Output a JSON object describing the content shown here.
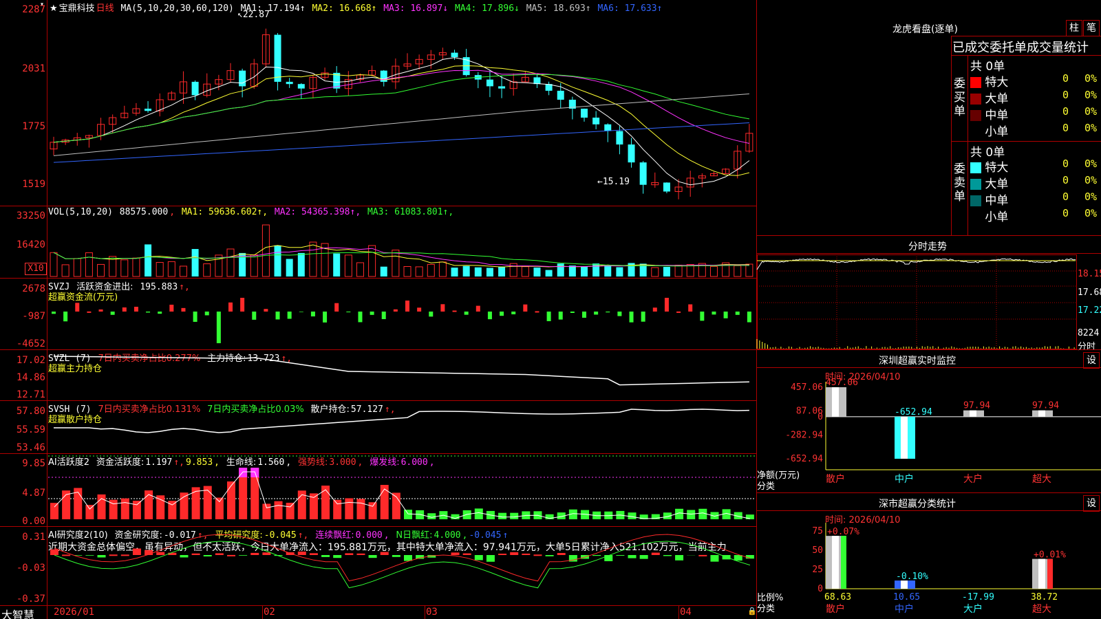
{
  "stock": {
    "name_prefix": "★",
    "name": "宝鼎科技",
    "period": "日线"
  },
  "kline": {
    "ma_header": "MA(5,10,20,30,60,120)",
    "ma": [
      {
        "label": "MA1:",
        "value": "17.194",
        "arrow": "↑",
        "color": "#ffffff"
      },
      {
        "label": "MA2:",
        "value": "16.668",
        "arrow": "↑",
        "color": "#ffff33"
      },
      {
        "label": "MA3:",
        "value": "16.897",
        "arrow": "↓",
        "color": "#ff33ff"
      },
      {
        "label": "MA4:",
        "value": "17.896",
        "arrow": "↓",
        "color": "#33ff33"
      },
      {
        "label": "MA5:",
        "value": "18.693",
        "arrow": "↑",
        "color": "#c0c0c0"
      },
      {
        "label": "MA6:",
        "value": "17.633",
        "arrow": "↑",
        "color": "#3366ff"
      }
    ],
    "y_ticks": [
      "2287",
      "2031",
      "1775",
      "1519"
    ],
    "high_label": "22.87",
    "low_label": "15.19"
  },
  "vol": {
    "header": "VOL(5,10,20)",
    "value": "88575.000",
    "ma": [
      {
        "label": "MA1:",
        "value": "59636.602",
        "color": "#ffff33"
      },
      {
        "label": "MA2:",
        "value": "54365.398",
        "color": "#ff33ff"
      },
      {
        "label": "MA3:",
        "value": "61083.801",
        "color": "#33ff33"
      }
    ],
    "y_ticks": [
      "33250",
      "16420"
    ],
    "unit": "X10"
  },
  "svzj": {
    "name": "SVZJ",
    "label": "活跃资金进出:",
    "value": "195.883",
    "sub": "超赢资金流(万元)",
    "y_ticks": [
      "2678",
      "-987",
      "-4652"
    ]
  },
  "svzl": {
    "name": "SVZL (7)",
    "ratio_label": "7日内买卖净占比0.277%",
    "hold_label": "主力持仓:",
    "hold_value": "13.723",
    "sub": "超赢主力持仓",
    "y_ticks": [
      "17.02",
      "14.86",
      "12.71"
    ]
  },
  "svsh": {
    "name": "SVSH (7)",
    "ratio1": "7日内买卖净占比0.131%",
    "ratio2": "7日内买卖净占比0.03%",
    "hold_label": "散户持仓:",
    "hold_value": "57.127",
    "sub": "超赢散户持仓",
    "y_ticks": [
      "57.80",
      "55.59",
      "53.46"
    ]
  },
  "ai_active": {
    "name": "AI活跃度2",
    "label": "资金活跃度:",
    "value1": "1.197",
    "value2": "9.853",
    "life_label": "生命线:",
    "life_value": "1.560",
    "strong_label": "强势线:",
    "strong_value": "3.000",
    "burst_label": "爆发线:",
    "burst_value": "6.000",
    "y_ticks": [
      "9.85",
      "4.87",
      "0.00"
    ]
  },
  "ai_research": {
    "name": "AI研究度2(10)",
    "label": "资金研究度:",
    "value": "-0.017",
    "avg_label": "平均研究度:",
    "avg_value": "-0.045",
    "cont_label": "连续飘红:",
    "cont_value": "0.000",
    "nday_label": "N日飘红:",
    "nday_value": "4.000",
    "last_value": "-0.045",
    "comment": "近期大资金总体偏空，虽有异动，但不太活跃，今日大单净流入：195.881万元，其中特大单净流入：97.941万元，大单5日累计净入521.102万元，当前主力",
    "y_ticks": [
      "0.31",
      "-0.03",
      "-0.37"
    ]
  },
  "x_axis": {
    "labels": [
      "2026/01",
      "02",
      "03",
      "04"
    ],
    "app_name": "大智慧"
  },
  "dragon": {
    "title": "龙虎看盘(逐单)",
    "btn_zhu": "柱",
    "btn_bi": "笔",
    "header": "已成交委托单成交量统计",
    "buy_side": "委买单",
    "sell_side": "委卖单",
    "buy_total": "共 0单",
    "sell_total": "共 0单",
    "buy_rows": [
      {
        "label": "特大",
        "count": "0",
        "pct": "0%",
        "color": "#ff0000"
      },
      {
        "label": "大单",
        "count": "0",
        "pct": "0%",
        "color": "#990000"
      },
      {
        "label": "中单",
        "count": "0",
        "pct": "0%",
        "color": "#660000"
      },
      {
        "label": "小单",
        "count": "0",
        "pct": "0%",
        "color": ""
      }
    ],
    "sell_rows": [
      {
        "label": "特大",
        "count": "0",
        "pct": "0%",
        "color": "#33ffff"
      },
      {
        "label": "大单",
        "count": "0",
        "pct": "0%",
        "color": "#009999"
      },
      {
        "label": "中单",
        "count": "0",
        "pct": "0%",
        "color": "#006666"
      },
      {
        "label": "小单",
        "count": "0",
        "pct": "0%",
        "color": ""
      }
    ]
  },
  "intraday": {
    "title": "分时走势",
    "y_ticks": [
      "18.15",
      "17.68",
      "17.22"
    ],
    "vol_label": "8224",
    "vol_unit": "分时"
  },
  "sz_monitor": {
    "title": "深圳超赢实时监控",
    "btn": "设",
    "time_label": "时间: 2026/04/10",
    "y_ticks": [
      "457.06",
      "87.06",
      "0",
      "-282.94",
      "-652.94"
    ],
    "y_label": "净额(万元)",
    "x_label": "分类",
    "categories": [
      "散户",
      "中户",
      "大户",
      "超大"
    ],
    "values": [
      457.06,
      -652.94,
      97.94,
      97.94
    ],
    "value_labels": [
      "457.06",
      "-652.94",
      "97.94",
      "97.94"
    ]
  },
  "sz_classify": {
    "title": "深市超赢分类统计",
    "btn": "设",
    "time_label": "时间: 2026/04/10",
    "y_ticks": [
      "75",
      "50",
      "25",
      "0"
    ],
    "y_label": "比例%",
    "x_label": "分类",
    "categories": [
      "散户",
      "中户",
      "大户",
      "超大"
    ],
    "bar_values": [
      0.07,
      -0.1,
      0,
      0.01
    ],
    "bar_labels": [
      "+0.07%",
      "-0.10%",
      "",
      "+0.01%"
    ],
    "bottom_values": [
      "68.63",
      "10.65",
      "-17.99",
      "38.72"
    ]
  }
}
